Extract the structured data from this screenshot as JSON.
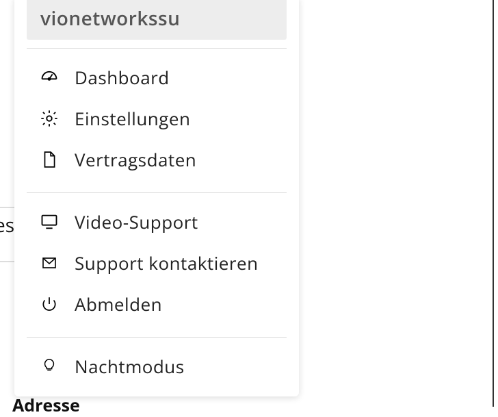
{
  "user": {
    "name": "vionetworkssu"
  },
  "menu": {
    "groups": [
      {
        "items": [
          {
            "icon": "dashboard-icon",
            "label": "Dashboard"
          },
          {
            "icon": "gear-icon",
            "label": "Einstellungen"
          },
          {
            "icon": "document-icon",
            "label": "Vertragsdaten"
          }
        ]
      },
      {
        "items": [
          {
            "icon": "monitor-icon",
            "label": "Video-Support"
          },
          {
            "icon": "mail-icon",
            "label": "Support kontaktieren"
          },
          {
            "icon": "power-icon",
            "label": "Abmelden"
          }
        ]
      },
      {
        "items": [
          {
            "icon": "lightbulb-icon",
            "label": "Nachtmodus"
          }
        ]
      }
    ]
  },
  "background": {
    "partial_word_left": "es",
    "partial_word_bottom": "Adresse"
  }
}
